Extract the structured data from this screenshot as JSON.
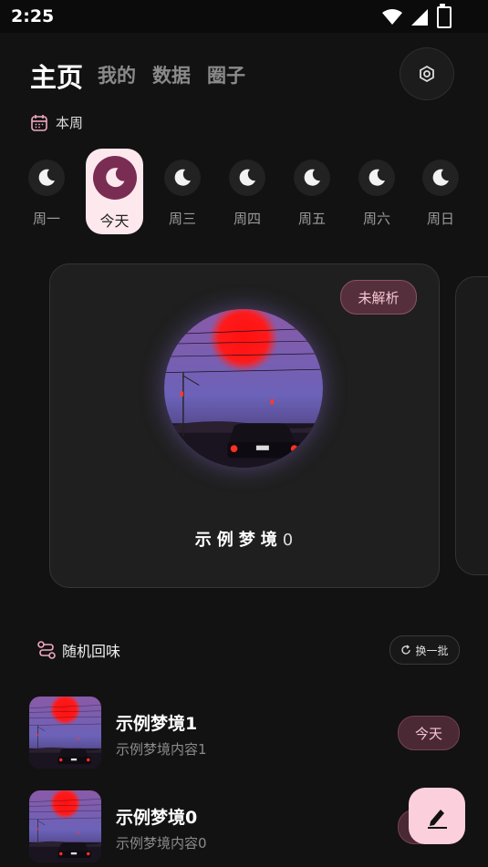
{
  "status": {
    "time": "2:25"
  },
  "nav": {
    "tabs": [
      "主页",
      "我的",
      "数据",
      "圈子"
    ]
  },
  "week": {
    "label": "本周",
    "days": [
      "周一",
      "今天",
      "周三",
      "周四",
      "周五",
      "周六",
      "周日"
    ]
  },
  "featured": {
    "badge": "未解析",
    "title": "示例梦境",
    "number": "0"
  },
  "random": {
    "label": "随机回味",
    "refresh": "换一批"
  },
  "list": [
    {
      "title": "示例梦境1",
      "subtitle": "示例梦境内容1",
      "tag": "今天"
    },
    {
      "title": "示例梦境0",
      "subtitle": "示例梦境内容0",
      "tag": "今天"
    }
  ],
  "colors": {
    "accent": "#fde8ee",
    "badge": "#55303c",
    "fab": "#fbd0dc"
  }
}
